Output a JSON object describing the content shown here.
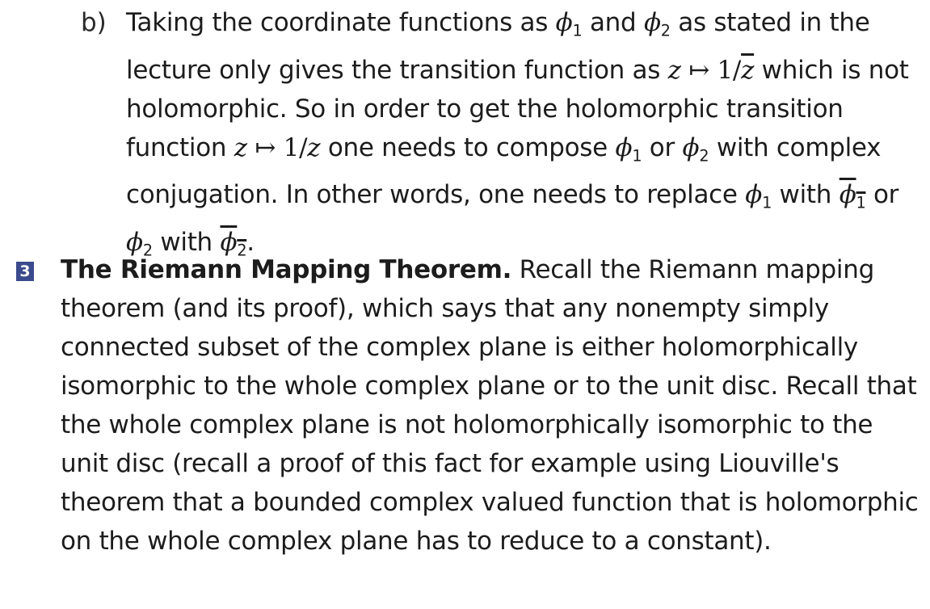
{
  "part_b": {
    "marker": "b)",
    "s1": "Taking the coordinate functions as",
    "phi": "ϕ",
    "one": "1",
    "two": "2",
    "and": "and",
    "s2": "as stated in the lecture only gives the transition function as",
    "z": "z",
    "mapsto": " ↦ ",
    "one_over": "1/",
    "s3": "which is not holomorphic. So in order to get the holomorphic transition function",
    "s4": "one needs to compose",
    "or": "or",
    "s5": "with complex conjugation. In other words, one needs to replace",
    "with": "with",
    "period": "."
  },
  "problem3": {
    "number": "3",
    "title": "The Riemann Mapping Theorem.",
    "body": "Recall the Riemann mapping theorem (and its proof), which says that any nonempty simply connected subset of the complex plane is either holomorphically isomorphic to the whole complex plane or to the unit disc. Recall that the whole complex plane is not holomorphically isomorphic to the unit disc (recall a proof of this fact for example using Liouville's theorem that a bounded complex valued function that is holomorphic on the whole complex plane has to reduce to a constant)."
  }
}
